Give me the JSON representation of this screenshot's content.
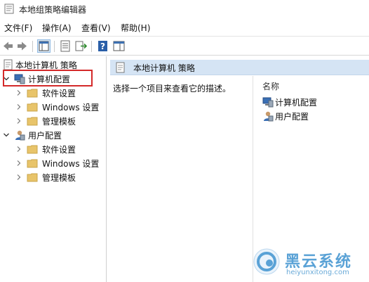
{
  "window": {
    "title": "本地组策略编辑器"
  },
  "menu": [
    {
      "label": "文件(F)"
    },
    {
      "label": "操作(A)"
    },
    {
      "label": "查看(V)"
    },
    {
      "label": "帮助(H)"
    }
  ],
  "toolbar": {
    "buttons": [
      {
        "icon": "back-arrow-icon"
      },
      {
        "icon": "forward-arrow-icon"
      },
      {
        "icon": "show-hide-console-tree-icon"
      },
      {
        "icon": "properties-icon"
      },
      {
        "icon": "export-list-icon"
      },
      {
        "icon": "help-icon"
      },
      {
        "icon": "show-hide-action-pane-icon"
      }
    ]
  },
  "tree": {
    "root": "本地计算机 策略",
    "computer_config": "计算机配置",
    "computer_children": [
      "软件设置",
      "Windows 设置",
      "管理模板"
    ],
    "user_config": "用户配置",
    "user_children": [
      "软件设置",
      "Windows 设置",
      "管理模板"
    ]
  },
  "content": {
    "header": "本地计算机 策略",
    "description": "选择一个项目来查看它的描述。",
    "column_name": "名称",
    "items": [
      "计算机配置",
      "用户配置"
    ]
  },
  "watermark": {
    "name": "黑云系统",
    "url": "heiyunxitong.com"
  },
  "colors": {
    "highlight": "#d42a2a",
    "header_bg": "#d5e4f4",
    "folder": "#e8c46a",
    "watermark": "#5aa2d6"
  }
}
